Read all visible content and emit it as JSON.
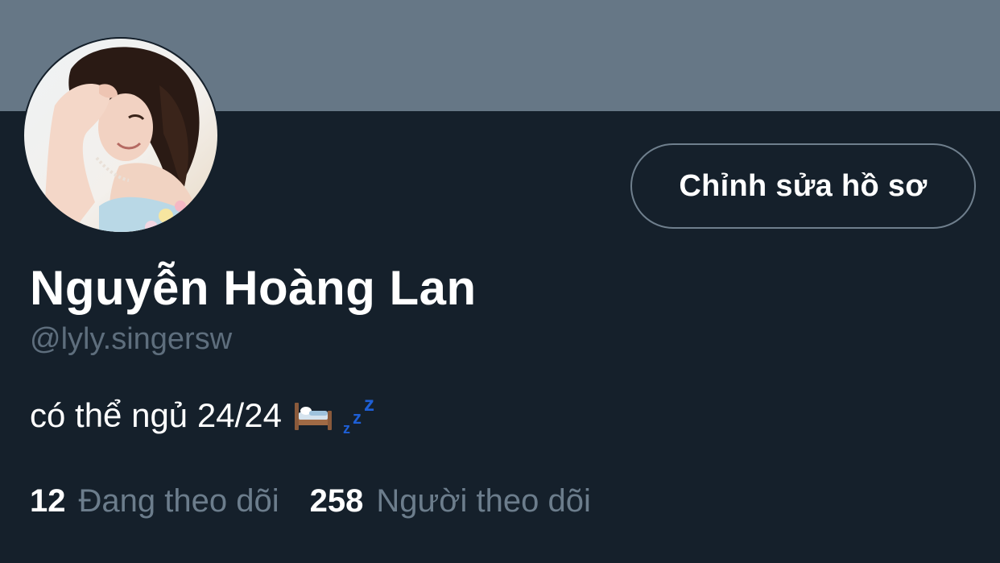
{
  "profile": {
    "display_name": "Nguyễn Hoàng Lan",
    "handle": "@lyly.singersw",
    "bio_text": "có thể ngủ 24/24",
    "bio_emojis": [
      "bed-icon",
      "zzz-icon"
    ]
  },
  "actions": {
    "edit_profile_label": "Chỉnh sửa hồ sơ"
  },
  "stats": {
    "following": {
      "count": "12",
      "label": "Đang theo dõi"
    },
    "followers": {
      "count": "258",
      "label": "Người theo dõi"
    }
  },
  "colors": {
    "background": "#15202b",
    "banner": "#667786",
    "secondary_text": "#6c7d8c",
    "button_border": "#6f7f8d"
  }
}
